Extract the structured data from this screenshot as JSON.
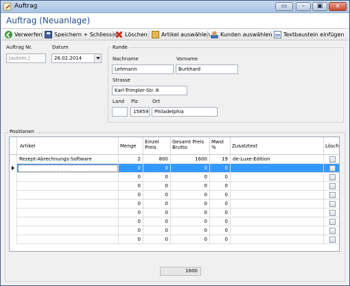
{
  "window": {
    "title": "Auftrag",
    "minimize_glyph": "▭",
    "maximize_glyph": "▣",
    "close_glyph": "x"
  },
  "header": {
    "title": "Auftrag (Neuanlage)"
  },
  "toolbar": {
    "discard": "Verwerfen",
    "save_close": "Speichern + Schliessen",
    "delete": "Löschen",
    "select_article": "Artikel auswählen",
    "select_customer": "Kunden auswählen",
    "insert_text": "Textbaustein einfügen"
  },
  "order": {
    "number_label": "Auftrag Nr.",
    "number_value": "[autom.]",
    "date_label": "Datum",
    "date_value": "26.02.2014"
  },
  "customer": {
    "group_label": "Kunde",
    "lastname_label": "Nachname",
    "lastname_value": "Lehmann",
    "firstname_label": "Vorname",
    "firstname_value": "Burkhard",
    "street_label": "Strasse",
    "street_value": "Karl-Trimpler-Str. 8",
    "country_label": "Land",
    "country_value": "",
    "zip_label": "Plz",
    "zip_value": "15859",
    "city_label": "Ort",
    "city_value": "Philadelphia"
  },
  "positions": {
    "group_label": "Positionen",
    "columns": [
      "Artikel",
      "Menge",
      "Einzel\nPreis",
      "Gesamt Preis\nBrutto",
      "Mwst\n%",
      "Zusatztext",
      "Löschen?"
    ],
    "rows": [
      [
        "Rezept-Abrechnungs-Software",
        "2",
        "800",
        "1600",
        "19",
        "de-Luxe-Edition"
      ],
      [
        "",
        "0",
        "0",
        "0",
        "0",
        ""
      ],
      [
        "",
        "0",
        "0",
        "0",
        "0",
        ""
      ],
      [
        "",
        "0",
        "0",
        "0",
        "0",
        ""
      ],
      [
        "",
        "0",
        "0",
        "0",
        "0",
        ""
      ],
      [
        "",
        "0",
        "0",
        "0",
        "0",
        ""
      ],
      [
        "",
        "0",
        "0",
        "0",
        "0",
        ""
      ],
      [
        "",
        "0",
        "0",
        "0",
        "0",
        ""
      ],
      [
        "",
        "0",
        "0",
        "0",
        "0",
        ""
      ],
      [
        "",
        "0",
        "0",
        "0",
        "0",
        ""
      ]
    ],
    "selected_row": 1,
    "total": "1600"
  },
  "colors": {
    "selection": "#3399ff",
    "header_title": "#1f4e8c"
  }
}
